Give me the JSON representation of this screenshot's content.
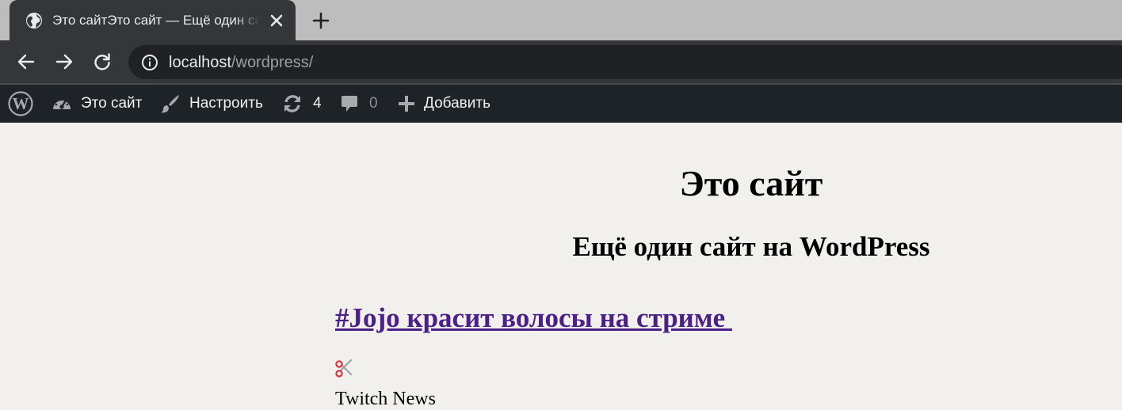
{
  "browser": {
    "tab_title": "Это сайтЭто сайт — Ещё один сайт на WordPress",
    "url_host": "localhost",
    "url_path": "/wordpress/"
  },
  "admin_bar": {
    "site_name": "Это сайт",
    "customize": "Настроить",
    "updates_count": "4",
    "comments_count": "0",
    "new_label": "Добавить"
  },
  "site": {
    "title": "Это сайт",
    "description": "Ещё один сайт на WordPress"
  },
  "post": {
    "title": "#Jojo красит волосы на стриме ",
    "emoji_icon": "scissors-icon",
    "line": "Twitch News"
  },
  "colors": {
    "admin_bar_bg": "#1d2327",
    "page_bg": "#f1f0ec",
    "link_visited": "#4b2188"
  }
}
